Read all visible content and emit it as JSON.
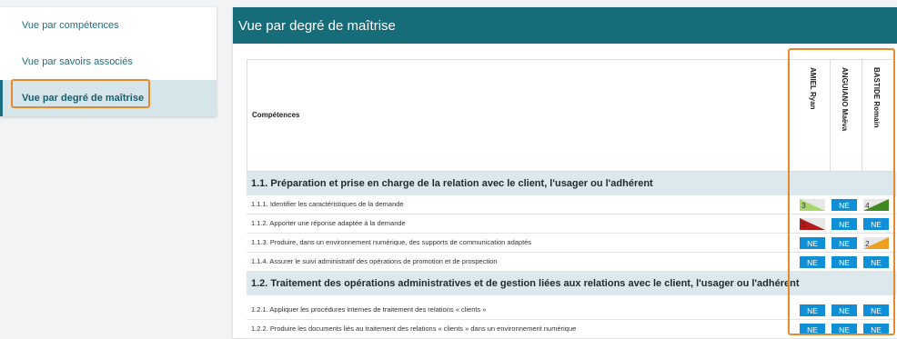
{
  "sidebar": {
    "items": [
      {
        "label": "Vue par compétences"
      },
      {
        "label": "Vue par savoirs associés"
      },
      {
        "label": "Vue par degré de maîtrise"
      }
    ]
  },
  "panel": {
    "title": "Vue par degré de maîtrise",
    "table": {
      "header_label": "Compétences",
      "students": [
        "AMIEL Ryan",
        "ANGUIANO Maëva",
        "BASTIDE Romain"
      ],
      "sections": [
        {
          "title": "1.1. Préparation et prise en charge de la relation avec le client, l'usager ou l'adhérent",
          "rows": [
            {
              "label": "1.1.1. Identifier les caractéristiques de la demande",
              "cells": [
                "3",
                "NE",
                "4"
              ]
            },
            {
              "label": "1.1.2. Apporter une réponse adaptée à la demande",
              "cells": [
                "1",
                "NE",
                "NE"
              ]
            },
            {
              "label": "1.1.3. Produire, dans un environnement numérique, des supports de communication adaptés",
              "cells": [
                "NE",
                "NE",
                "2"
              ]
            },
            {
              "label": "1.1.4. Assurer le suivi administratif des opérations de promotion et de prospection",
              "cells": [
                "NE",
                "NE",
                "NE"
              ]
            }
          ]
        },
        {
          "title": "1.2. Traitement des opérations administratives et de gestion liées aux relations avec le client, l'usager ou l'adhérent",
          "rows": [
            {
              "label": "1.2.1. Appliquer les procédures internes de traitement des relations « clients »",
              "cells": [
                "NE",
                "NE",
                "NE"
              ]
            },
            {
              "label": "1.2.2. Produire les documents liés au traitement des relations « clients » dans un environnement numérique",
              "cells": [
                "NE",
                "NE",
                "NE"
              ]
            }
          ]
        }
      ]
    }
  },
  "colors": {
    "header_bg": "#176c7a",
    "ne_badge": "#0e8fd6",
    "level_1": "#b01c1c",
    "level_2": "#f0a020",
    "level_3": "#a8d86a",
    "level_4": "#3f8a1f",
    "highlight": "#e58a2c"
  }
}
